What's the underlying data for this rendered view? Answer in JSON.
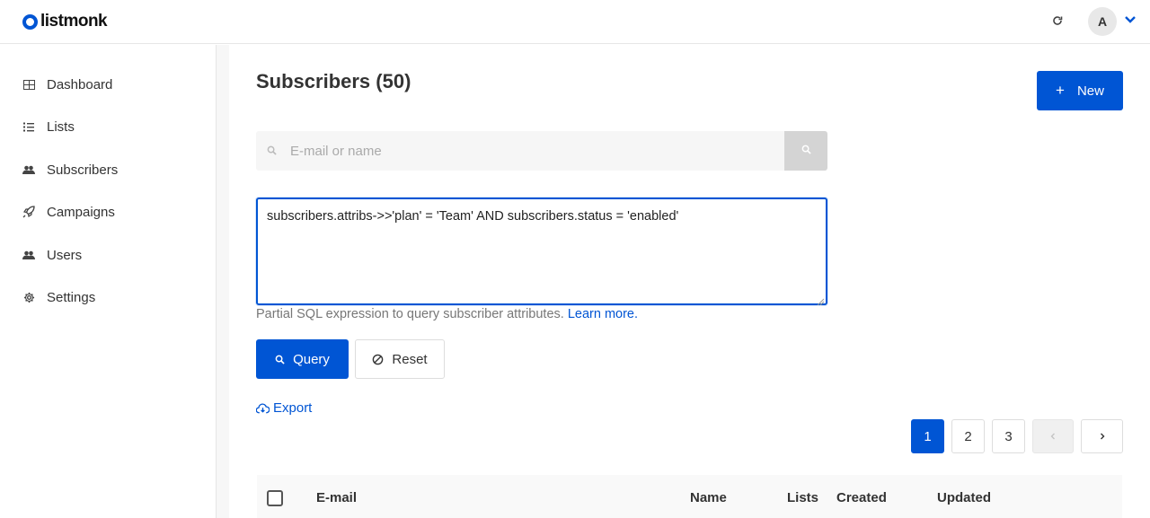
{
  "app": {
    "name": "listmonk",
    "brand_color": "#0055d4"
  },
  "header": {
    "avatar_initial": "A"
  },
  "sidebar": {
    "items": [
      {
        "label": "Dashboard",
        "icon": "dashboard-icon"
      },
      {
        "label": "Lists",
        "icon": "list-icon"
      },
      {
        "label": "Subscribers",
        "icon": "users-icon"
      },
      {
        "label": "Campaigns",
        "icon": "rocket-icon"
      },
      {
        "label": "Users",
        "icon": "users-icon"
      },
      {
        "label": "Settings",
        "icon": "gear-icon"
      }
    ]
  },
  "main": {
    "title": "Subscribers (50)",
    "new_label": "New",
    "search": {
      "placeholder": "E-mail or name"
    },
    "query": {
      "value": "subscribers.attribs->>'plan' = 'Team' AND subscribers.status = 'enabled'",
      "help_text": "Partial SQL expression to query subscriber attributes.",
      "help_link": "Learn more."
    },
    "query_label": "Query",
    "reset_label": "Reset",
    "export_label": "Export",
    "pagination": {
      "pages": [
        "1",
        "2",
        "3"
      ],
      "current": "1"
    },
    "table": {
      "columns": [
        "E-mail",
        "Name",
        "Lists",
        "Created",
        "Updated"
      ]
    }
  }
}
